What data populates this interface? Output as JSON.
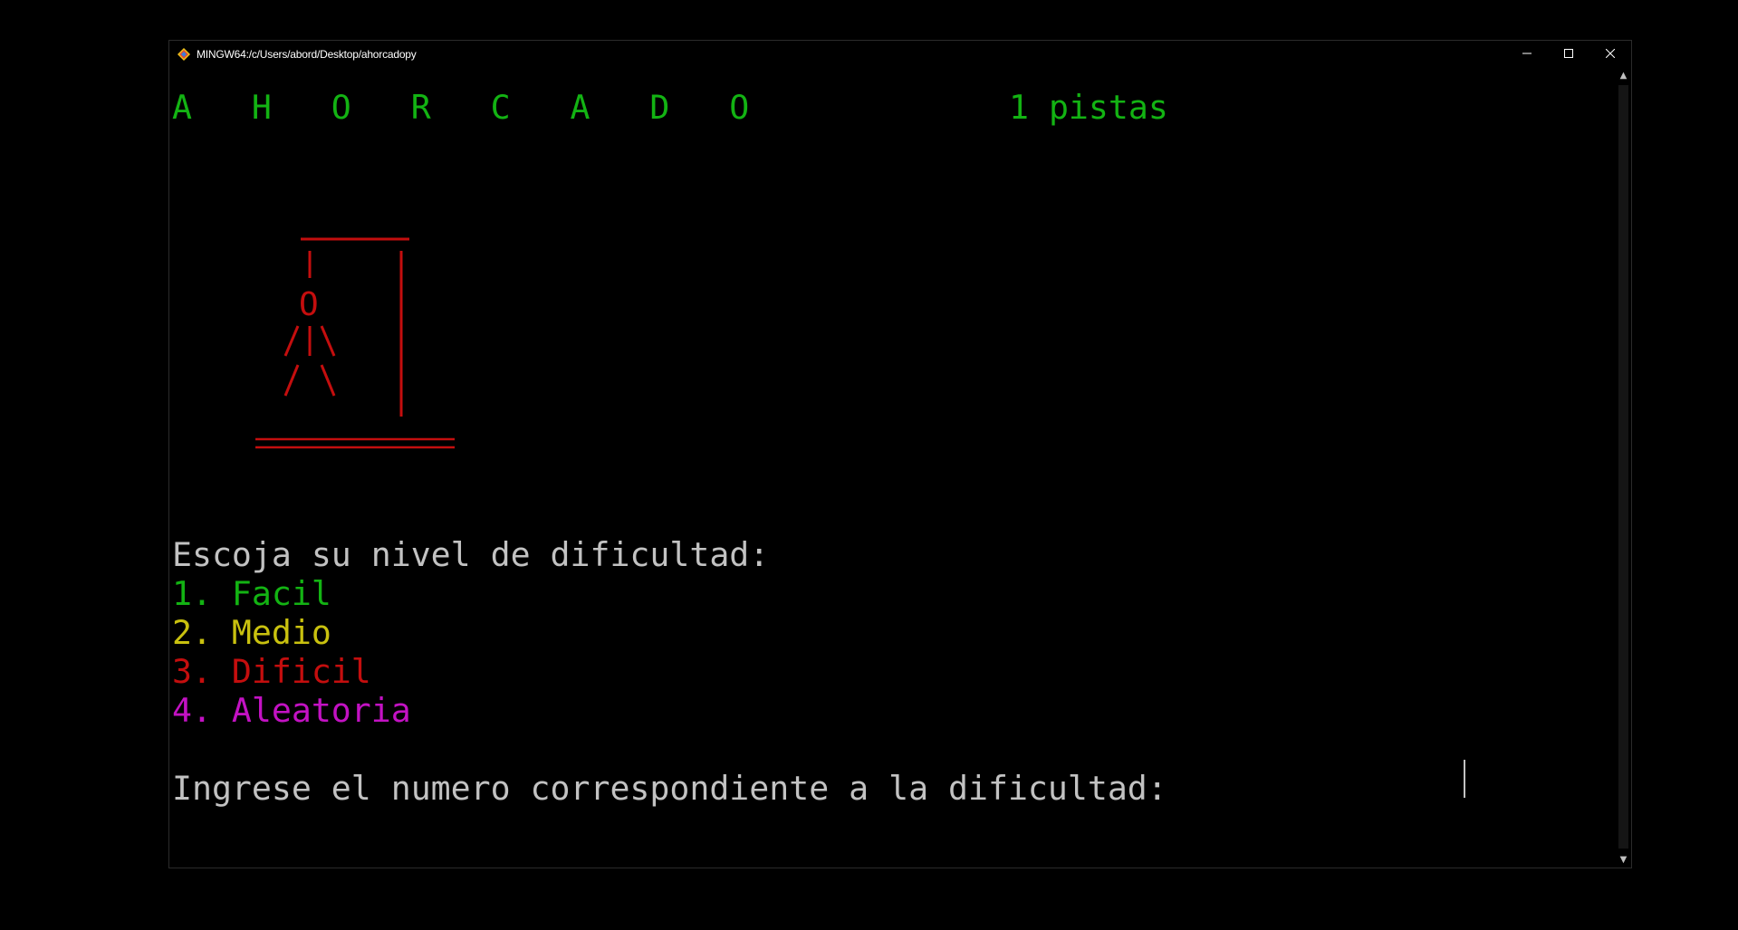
{
  "window": {
    "title": "MINGW64:/c/Users/abord/Desktop/ahorcadopy",
    "controls": {
      "minimize_icon": "minimize-icon",
      "maximize_icon": "maximize-icon",
      "close_icon": "close-icon"
    }
  },
  "terminal": {
    "game_title": "A   H   O   R   C   A   D   O",
    "hints": "1 pistas",
    "hangman_art": [
      "   _____",
      "   |   |",
      "   O   |",
      "  /|\\  |",
      "  / \\  |",
      "       |",
      "=========="
    ],
    "difficulty_prompt": "Escoja su nivel de dificultad:",
    "options": [
      {
        "label": "1. Facil",
        "color": "#13b313"
      },
      {
        "label": "2. Medio",
        "color": "#c9c10f"
      },
      {
        "label": "3. Dificil",
        "color": "#c40e0e"
      },
      {
        "label": "4. Aleatoria",
        "color": "#c312c3"
      }
    ],
    "input_prompt": "Ingrese el numero correspondiente a la dificultad:"
  },
  "colors": {
    "background": "#000000",
    "title_green": "#13b313",
    "art_red": "#c40e0e",
    "text_gray": "#c2c2c2"
  }
}
